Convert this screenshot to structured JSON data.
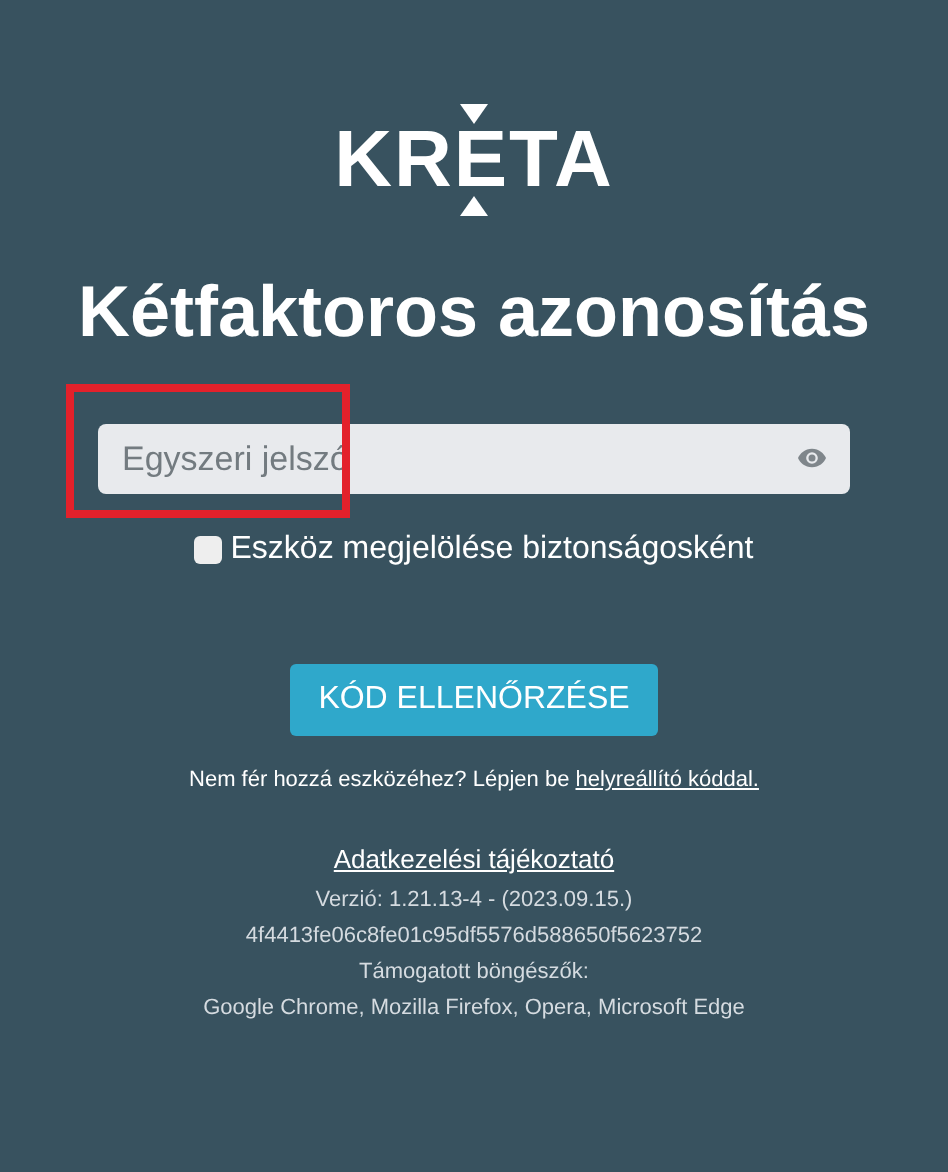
{
  "logo": {
    "text": "KRETA"
  },
  "title": "Kétfaktoros azonosítás",
  "code_field": {
    "placeholder": "Egyszeri jelszó",
    "highlighted": true
  },
  "remember_device": {
    "label": "Eszköz megjelölése biztonságosként",
    "checked": false
  },
  "submit_button": "KÓD ELLENŐRZÉSE",
  "recovery": {
    "text": "Nem fér hozzá eszközéhez? Lépjen be",
    "link": "helyreállító kóddal."
  },
  "footer": {
    "privacy_link": "Adatkezelési tájékoztató",
    "version": "Verzió: 1.21.13-4 - (2023.09.15.)",
    "hash": "4f4413fe06c8fe01c95df5576d588650f5623752",
    "browsers_label": "Támogatott böngészők:",
    "browsers": "Google Chrome, Mozilla Firefox, Opera, Microsoft Edge"
  }
}
